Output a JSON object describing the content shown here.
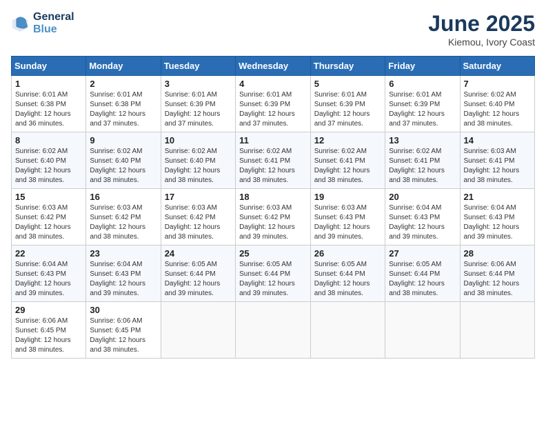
{
  "header": {
    "logo_line1": "General",
    "logo_line2": "Blue",
    "title": "June 2025",
    "location": "Kiemou, Ivory Coast"
  },
  "weekdays": [
    "Sunday",
    "Monday",
    "Tuesday",
    "Wednesday",
    "Thursday",
    "Friday",
    "Saturday"
  ],
  "weeks": [
    [
      {
        "day": "1",
        "sunrise": "6:01 AM",
        "sunset": "6:38 PM",
        "daylight": "12 hours and 36 minutes."
      },
      {
        "day": "2",
        "sunrise": "6:01 AM",
        "sunset": "6:38 PM",
        "daylight": "12 hours and 37 minutes."
      },
      {
        "day": "3",
        "sunrise": "6:01 AM",
        "sunset": "6:39 PM",
        "daylight": "12 hours and 37 minutes."
      },
      {
        "day": "4",
        "sunrise": "6:01 AM",
        "sunset": "6:39 PM",
        "daylight": "12 hours and 37 minutes."
      },
      {
        "day": "5",
        "sunrise": "6:01 AM",
        "sunset": "6:39 PM",
        "daylight": "12 hours and 37 minutes."
      },
      {
        "day": "6",
        "sunrise": "6:01 AM",
        "sunset": "6:39 PM",
        "daylight": "12 hours and 37 minutes."
      },
      {
        "day": "7",
        "sunrise": "6:02 AM",
        "sunset": "6:40 PM",
        "daylight": "12 hours and 38 minutes."
      }
    ],
    [
      {
        "day": "8",
        "sunrise": "6:02 AM",
        "sunset": "6:40 PM",
        "daylight": "12 hours and 38 minutes."
      },
      {
        "day": "9",
        "sunrise": "6:02 AM",
        "sunset": "6:40 PM",
        "daylight": "12 hours and 38 minutes."
      },
      {
        "day": "10",
        "sunrise": "6:02 AM",
        "sunset": "6:40 PM",
        "daylight": "12 hours and 38 minutes."
      },
      {
        "day": "11",
        "sunrise": "6:02 AM",
        "sunset": "6:41 PM",
        "daylight": "12 hours and 38 minutes."
      },
      {
        "day": "12",
        "sunrise": "6:02 AM",
        "sunset": "6:41 PM",
        "daylight": "12 hours and 38 minutes."
      },
      {
        "day": "13",
        "sunrise": "6:02 AM",
        "sunset": "6:41 PM",
        "daylight": "12 hours and 38 minutes."
      },
      {
        "day": "14",
        "sunrise": "6:03 AM",
        "sunset": "6:41 PM",
        "daylight": "12 hours and 38 minutes."
      }
    ],
    [
      {
        "day": "15",
        "sunrise": "6:03 AM",
        "sunset": "6:42 PM",
        "daylight": "12 hours and 38 minutes."
      },
      {
        "day": "16",
        "sunrise": "6:03 AM",
        "sunset": "6:42 PM",
        "daylight": "12 hours and 38 minutes."
      },
      {
        "day": "17",
        "sunrise": "6:03 AM",
        "sunset": "6:42 PM",
        "daylight": "12 hours and 38 minutes."
      },
      {
        "day": "18",
        "sunrise": "6:03 AM",
        "sunset": "6:42 PM",
        "daylight": "12 hours and 39 minutes."
      },
      {
        "day": "19",
        "sunrise": "6:03 AM",
        "sunset": "6:43 PM",
        "daylight": "12 hours and 39 minutes."
      },
      {
        "day": "20",
        "sunrise": "6:04 AM",
        "sunset": "6:43 PM",
        "daylight": "12 hours and 39 minutes."
      },
      {
        "day": "21",
        "sunrise": "6:04 AM",
        "sunset": "6:43 PM",
        "daylight": "12 hours and 39 minutes."
      }
    ],
    [
      {
        "day": "22",
        "sunrise": "6:04 AM",
        "sunset": "6:43 PM",
        "daylight": "12 hours and 39 minutes."
      },
      {
        "day": "23",
        "sunrise": "6:04 AM",
        "sunset": "6:43 PM",
        "daylight": "12 hours and 39 minutes."
      },
      {
        "day": "24",
        "sunrise": "6:05 AM",
        "sunset": "6:44 PM",
        "daylight": "12 hours and 39 minutes."
      },
      {
        "day": "25",
        "sunrise": "6:05 AM",
        "sunset": "6:44 PM",
        "daylight": "12 hours and 39 minutes."
      },
      {
        "day": "26",
        "sunrise": "6:05 AM",
        "sunset": "6:44 PM",
        "daylight": "12 hours and 38 minutes."
      },
      {
        "day": "27",
        "sunrise": "6:05 AM",
        "sunset": "6:44 PM",
        "daylight": "12 hours and 38 minutes."
      },
      {
        "day": "28",
        "sunrise": "6:06 AM",
        "sunset": "6:44 PM",
        "daylight": "12 hours and 38 minutes."
      }
    ],
    [
      {
        "day": "29",
        "sunrise": "6:06 AM",
        "sunset": "6:45 PM",
        "daylight": "12 hours and 38 minutes."
      },
      {
        "day": "30",
        "sunrise": "6:06 AM",
        "sunset": "6:45 PM",
        "daylight": "12 hours and 38 minutes."
      },
      null,
      null,
      null,
      null,
      null
    ]
  ]
}
